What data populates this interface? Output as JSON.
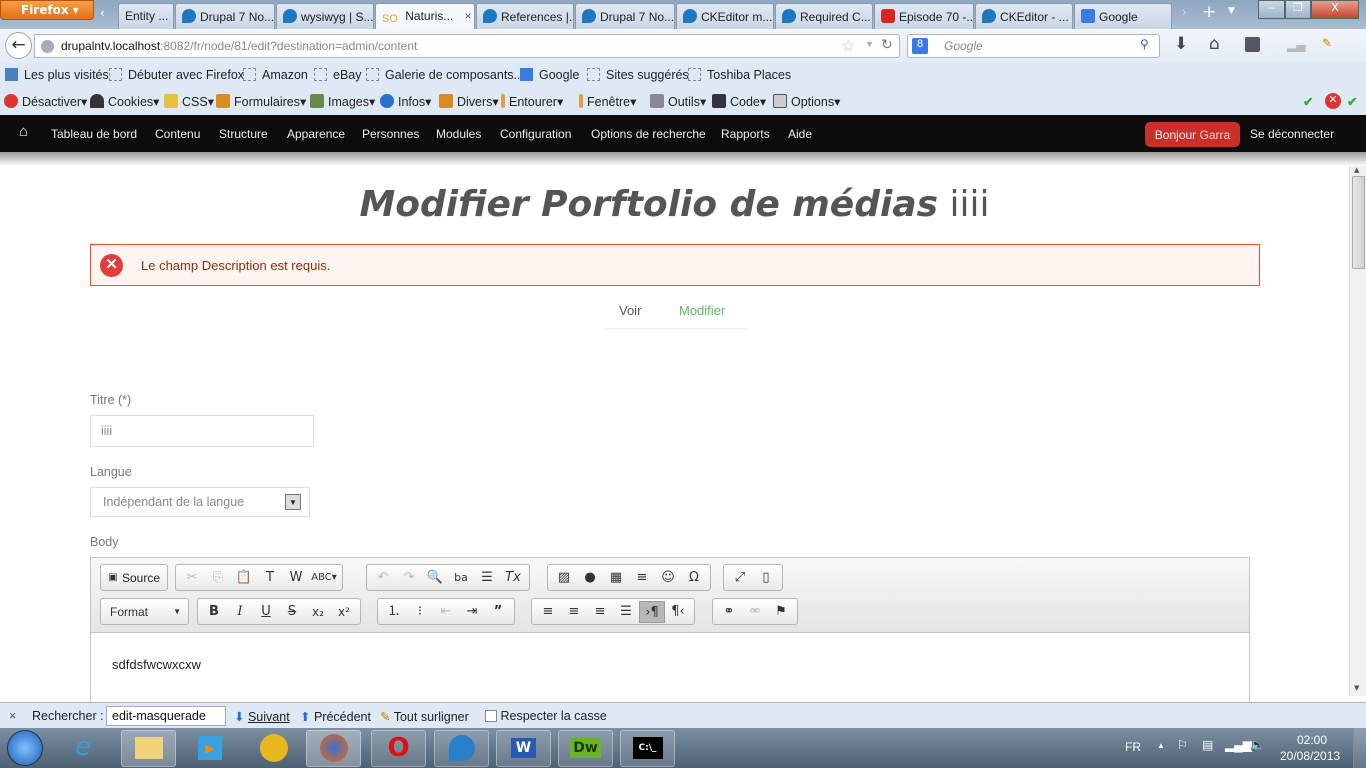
{
  "browser": {
    "menu_button": "Firefox",
    "tabs": [
      {
        "label": "Entity ...",
        "icon": "page"
      },
      {
        "label": "Drupal 7 No...",
        "icon": "drupal"
      },
      {
        "label": "wysiwyg | S...",
        "icon": "drupal"
      },
      {
        "label": "Naturis...",
        "icon": "so",
        "prefix": "SO",
        "active": true
      },
      {
        "label": "References |...",
        "icon": "drupal"
      },
      {
        "label": "Drupal 7 No...",
        "icon": "drupal"
      },
      {
        "label": "CKEditor m...",
        "icon": "drupal"
      },
      {
        "label": "Required C...",
        "icon": "drupal"
      },
      {
        "label": "Episode 70 -...",
        "icon": "youtube"
      },
      {
        "label": "CKEditor - ...",
        "icon": "drupal"
      },
      {
        "label": "Google",
        "icon": "google"
      }
    ],
    "url_host": "drupalntv.localhost",
    "url_rest": ":8082/fr/node/81/edit?destination=admin/content",
    "search_placeholder": "Google",
    "bookmarks": [
      "Les plus visités",
      "Débuter avec Firefox",
      "Amazon",
      "eBay",
      "Galerie de composants...",
      "Google",
      "Sites suggérés",
      "Toshiba Places"
    ],
    "webdev": [
      "Désactiver",
      "Cookies",
      "CSS",
      "Formulaires",
      "Images",
      "Infos",
      "Divers",
      "Entourer",
      "Fenêtre",
      "Outils",
      "Code",
      "Options"
    ]
  },
  "admin": {
    "items": [
      "Tableau de bord",
      "Contenu",
      "Structure",
      "Apparence",
      "Personnes",
      "Modules",
      "Configuration",
      "Options de recherche",
      "Rapports",
      "Aide"
    ],
    "hello": "Bonjour",
    "user": "Garra",
    "logout": "Se déconnecter"
  },
  "page": {
    "title_em": "Modifier Porftolio de médias",
    "title_rest": "iiii",
    "error": "Le champ Description est requis.",
    "tabs": [
      "Voir",
      "Modifier"
    ],
    "title_label": "Titre (*)",
    "title_value": "iiii",
    "lang_label": "Langue",
    "lang_value": "Indépendant de la langue",
    "body_label": "Body",
    "editor": {
      "source": "Source",
      "format": "Format",
      "content": "sdfdsfwcwxcxw"
    }
  },
  "findbar": {
    "label": "Rechercher :",
    "value": "edit-masquerade",
    "next": "Suivant",
    "prev": "Précédent",
    "highlight": "Tout surligner",
    "matchcase": "Respecter la casse"
  },
  "taskbar": {
    "lang": "FR",
    "time": "02:00",
    "date": "20/08/2013"
  },
  "colors": {
    "accent": "#5cb85c",
    "error_border": "#ed541d",
    "hello_bg": "#c9302c"
  }
}
